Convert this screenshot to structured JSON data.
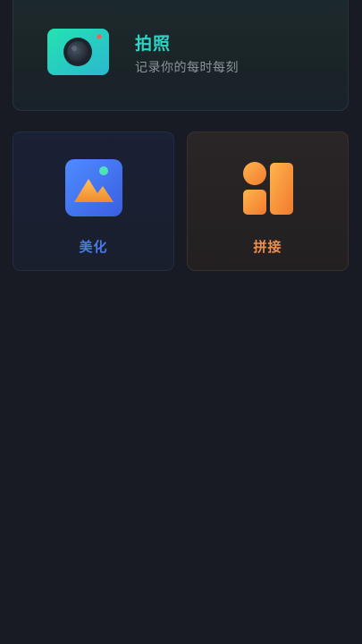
{
  "camera_card": {
    "title": "拍照",
    "subtitle": "记录你的每时每刻",
    "icon": "camera-icon",
    "title_color": "#2fd3c6"
  },
  "tiles": [
    {
      "label": "美化",
      "icon": "image-landscape-icon",
      "color": "#4a79ea"
    },
    {
      "label": "拼接",
      "icon": "collage-icon",
      "color": "#ee8f4a"
    }
  ],
  "colors": {
    "background": "#181b23",
    "camera_gradient_start": "#23e3b0",
    "camera_gradient_end": "#2bb8d0",
    "beautify_gradient_start": "#4f8cff",
    "beautify_gradient_end": "#3a5ee0",
    "collage_gradient_start": "#ffb44d",
    "collage_gradient_end": "#f07a2e"
  }
}
